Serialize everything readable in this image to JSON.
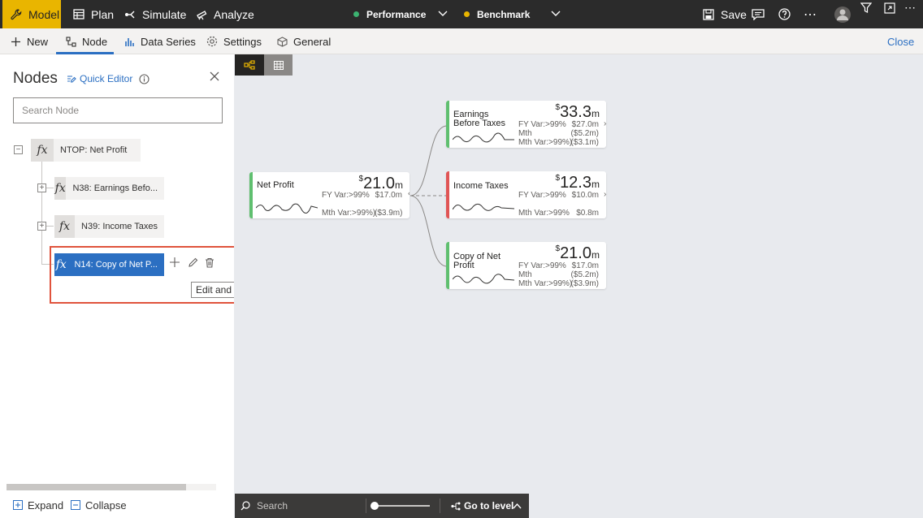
{
  "topbar": {
    "model_label": "Model",
    "plan_label": "Plan",
    "simulate_label": "Simulate",
    "analyze_label": "Analyze",
    "performance": {
      "label": "Performance",
      "dot_color": "#3cb371"
    },
    "benchmark": {
      "label": "Benchmark",
      "dot_color": "#e9b500"
    },
    "save_label": "Save",
    "accent_color": "#e9b500"
  },
  "secondary_bar": {
    "new_label": "New",
    "node_label": "Node",
    "data_series_label": "Data Series",
    "settings_label": "Settings",
    "general_label": "General",
    "close_label": "Close"
  },
  "panel": {
    "title": "Nodes",
    "quick_editor_label": "Quick Editor",
    "search_placeholder": "Search Node",
    "fx_symbol": "fx",
    "tree": [
      {
        "label": "NTOP: Net Profit"
      },
      {
        "label": "N38: Earnings Befo..."
      },
      {
        "label": "N39: Income Taxes"
      },
      {
        "label": "N14: Copy of Net P...",
        "selected": true
      }
    ],
    "tooltip": "Edit and Configure Node",
    "expand_label": "Expand",
    "collapse_label": "Collapse"
  },
  "canvas": {
    "cards": [
      {
        "title": "Net Profit",
        "currency": "$",
        "value": "21.0",
        "unit": "m",
        "bar_color": "#5fbf6f",
        "fy_label": "FY Var:>99%",
        "fy_value": "$17.0m",
        "mth_label": "Mth Var:>99%)",
        "mth_value": "($3.9m)"
      },
      {
        "title": "Earnings Before Taxes",
        "currency": "$",
        "value": "33.3",
        "unit": "m",
        "bar_color": "#5fbf6f",
        "fy_label": "FY Var:>99%",
        "fy_value": "$27.0m",
        "mth_label": "Mth",
        "mth_value": "($5.2m)",
        "mth2_label": "Mth Var:>99%)",
        "mth2_value": "($3.1m)"
      },
      {
        "title": "Income Taxes",
        "currency": "$",
        "value": "12.3",
        "unit": "m",
        "bar_color": "#e05555",
        "fy_label": "FY Var:>99%",
        "fy_value": "$10.0m",
        "mth_label": "Mth Var:>99%",
        "mth_value": "$0.8m"
      },
      {
        "title": "Copy of Net Profit",
        "currency": "$",
        "value": "21.0",
        "unit": "m",
        "bar_color": "#5fbf6f",
        "fy_label": "FY Var:>99%",
        "fy_value": "$17.0m",
        "mth_label": "Mth",
        "mth_value": "($5.2m)",
        "mth2_label": "Mth Var:>99%)",
        "mth2_value": "($3.9m)"
      }
    ]
  },
  "statusbar": {
    "search_label": "Search",
    "go_to_level_label": "Go to level"
  }
}
